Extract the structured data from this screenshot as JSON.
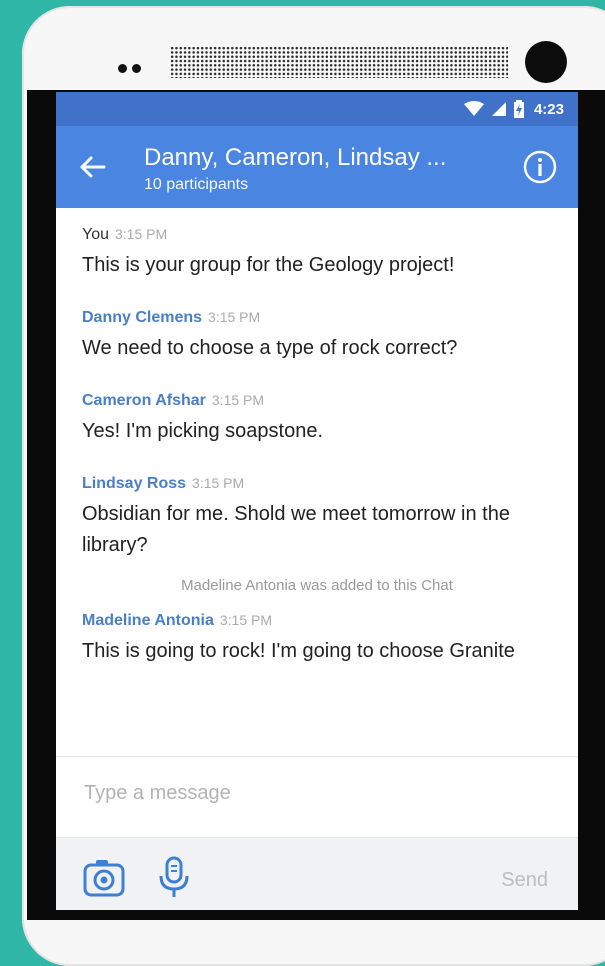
{
  "status_bar": {
    "time": "4:23",
    "icons": [
      "wifi-icon",
      "signal-icon",
      "battery-icon"
    ]
  },
  "app_bar": {
    "back_icon": "back-arrow-icon",
    "title": "Danny, Cameron, Lindsay ...",
    "subtitle": "10 participants",
    "info_icon": "info-icon"
  },
  "messages": [
    {
      "sender": "You",
      "time": "3:15 PM",
      "text": "This is your group for the Geology project!"
    },
    {
      "sender": "Danny Clemens",
      "time": "3:15 PM",
      "text": "We need to choose a type of rock correct?"
    },
    {
      "sender": "Cameron Afshar",
      "time": "3:15 PM",
      "text": "Yes! I'm picking soapstone."
    },
    {
      "sender": "Lindsay Ross",
      "time": "3:15 PM",
      "text": "Obsidian for me. Shold we meet tomorrow in the library?"
    }
  ],
  "system_message": "Madeline Antonia was added to this Chat",
  "last_message": {
    "sender": "Madeline Antonia",
    "time": "3:15 PM",
    "text": "This is going to rock! I'm going to choose Granite"
  },
  "composer": {
    "placeholder": "Type a message"
  },
  "bottom_bar": {
    "camera_icon": "camera-icon",
    "mic_icon": "microphone-icon",
    "send_label": "Send"
  },
  "colors": {
    "background": "#2fb6a6",
    "status_bar": "#3f72c8",
    "app_bar": "#4a86e1",
    "sender_name": "#4a7fc6"
  }
}
